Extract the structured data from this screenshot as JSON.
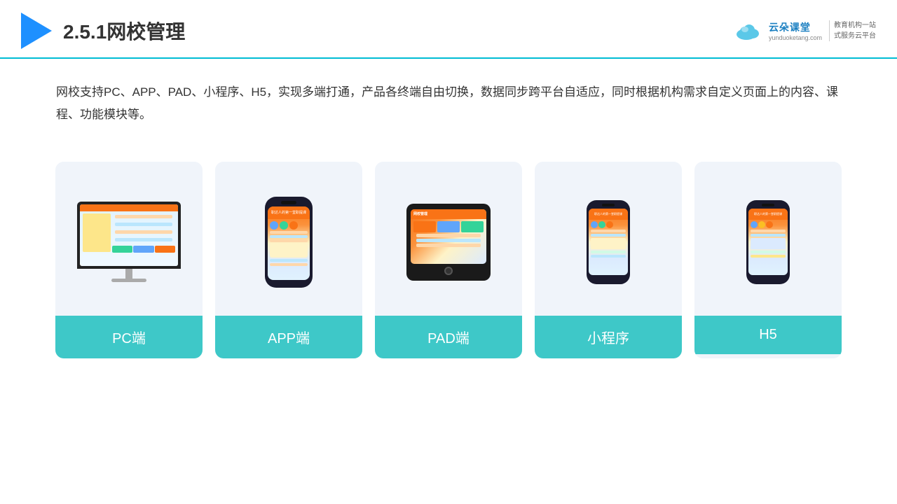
{
  "header": {
    "title": "2.5.1网校管理",
    "brand": {
      "name": "云朵课堂",
      "url": "yunduoketang.com",
      "slogan": "教育机构一站\n式服务云平台"
    }
  },
  "description": {
    "text": "网校支持PC、APP、PAD、小程序、H5，实现多端打通，产品各终端自由切换，数据同步跨平台自适应，同时根据机构需求自定义页面上的内容、课程、功能模块等。"
  },
  "cards": [
    {
      "id": "pc",
      "label": "PC端",
      "device_type": "monitor"
    },
    {
      "id": "app",
      "label": "APP端",
      "device_type": "phone"
    },
    {
      "id": "pad",
      "label": "PAD端",
      "device_type": "tablet"
    },
    {
      "id": "miniapp",
      "label": "小程序",
      "device_type": "phone_mini"
    },
    {
      "id": "h5",
      "label": "H5",
      "device_type": "phone_mini"
    }
  ],
  "colors": {
    "accent": "#3ec8c8",
    "header_line": "#00bcd4",
    "title": "#333333",
    "triangle": "#1e90ff",
    "brand_blue": "#1a7fc1"
  }
}
